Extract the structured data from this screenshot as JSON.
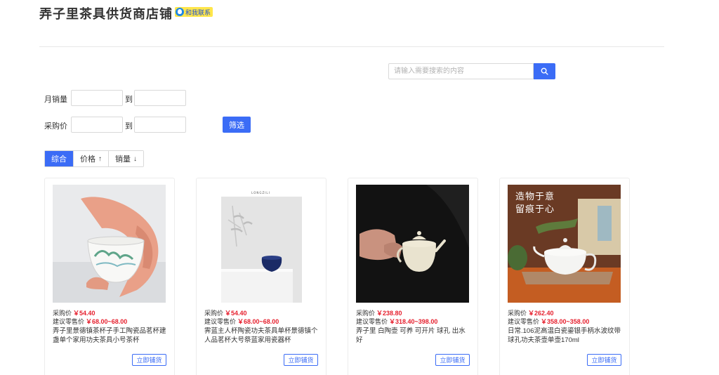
{
  "shop": {
    "title": "弄子里茶具供货商店铺",
    "contact_label": "和我联系"
  },
  "search": {
    "placeholder": "请输入需要搜索的内容",
    "icon": "search-icon"
  },
  "filters": {
    "monthly_sales_label": "月销量",
    "purchase_price_label": "采购价",
    "to_label": "到",
    "filter_button": "筛选"
  },
  "sort_tabs": [
    {
      "label": "综合",
      "arrow": "",
      "active": true
    },
    {
      "label": "价格",
      "arrow": "↑",
      "active": false
    },
    {
      "label": "销量",
      "arrow": "↓",
      "active": false
    }
  ],
  "products": [
    {
      "purchase_label": "采购价",
      "purchase_price": "￥54.40",
      "retail_label": "建议零售价",
      "retail_price": "￥68.00~68.00",
      "name": "弄子里景德镇茶杯子手工陶瓷品茗杯建盏单个家用功夫茶具小号茶杯",
      "button": "立即铺货"
    },
    {
      "purchase_label": "采购价",
      "purchase_price": "￥54.40",
      "retail_label": "建议零售价",
      "retail_price": "￥68.00~68.00",
      "name": "霁蓝主人杯陶瓷功夫茶具单杯景德镇个人品茗杯大号祭蓝家用瓷器杯",
      "button": "立即铺货",
      "image_caption": "LONGZILI"
    },
    {
      "purchase_label": "采购价",
      "purchase_price": "￥238.80",
      "retail_label": "建议零售价",
      "retail_price": "￥318.40~398.00",
      "name": "弄子里 白陶壶 可养 可开片 球孔 出水好",
      "button": "立即铺货"
    },
    {
      "purchase_label": "采购价",
      "purchase_price": "￥262.40",
      "retail_label": "建议零售价",
      "retail_price": "￥358.00~358.00",
      "name": "日常.106泥高温白瓷鎏银手柄水波纹带球孔功夫茶壶单壶170ml",
      "button": "立即铺货",
      "image_caption_1": "造物于意",
      "image_caption_2": "留痕于心"
    }
  ],
  "colors": {
    "accent": "#3b6cf6",
    "price": "#e6202e",
    "badge": "#ffe64a"
  }
}
